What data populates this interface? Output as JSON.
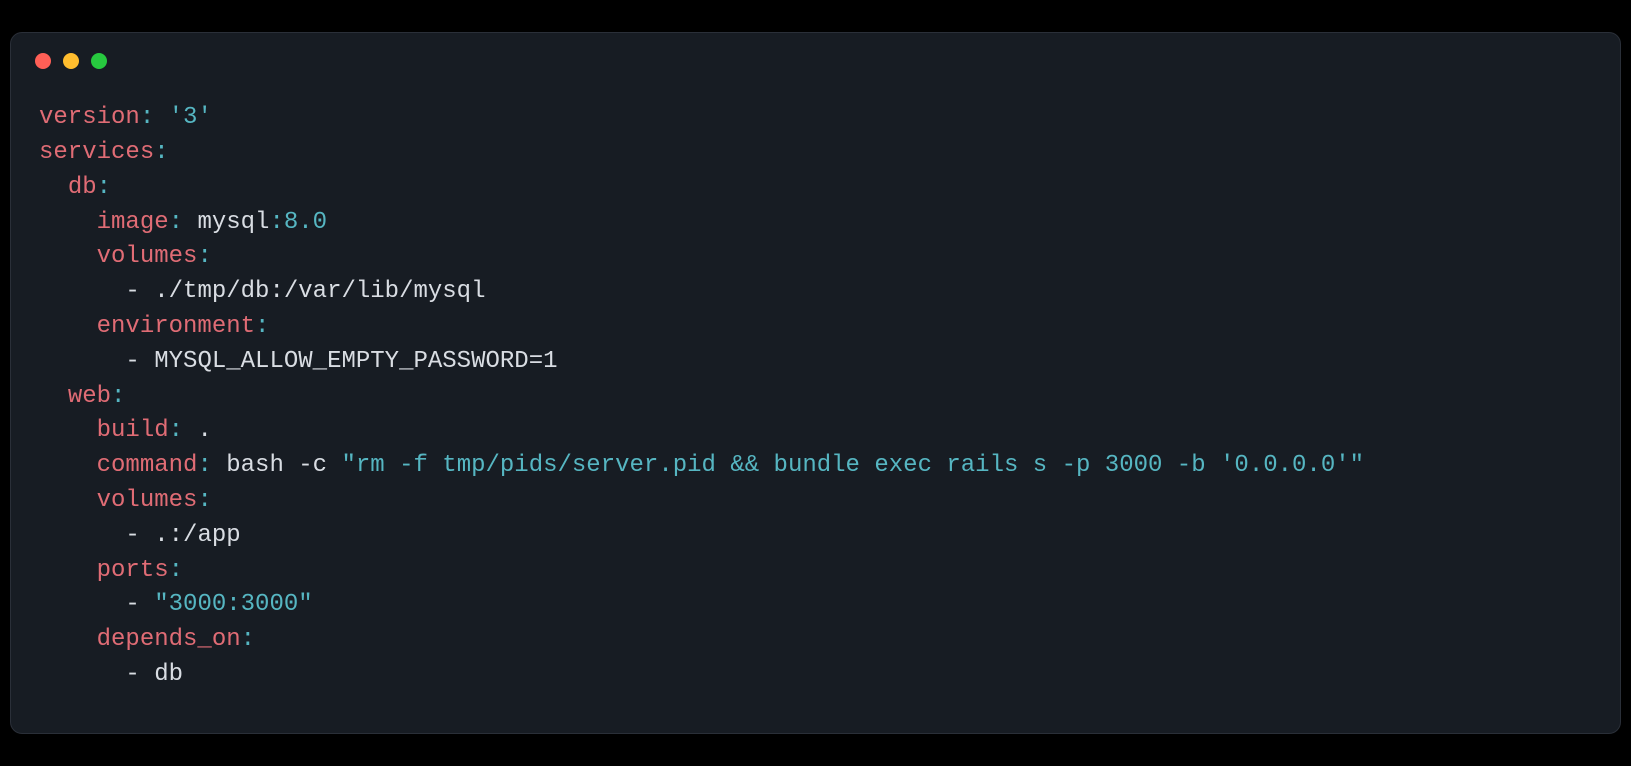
{
  "yaml": {
    "version_key": "version",
    "version_val": "'3'",
    "services_key": "services",
    "db_key": "db",
    "image_key": "image",
    "image_val_pre": "mysql",
    "image_val_post": "8.0",
    "volumes_key": "volumes",
    "db_volume": "./tmp/db:/var/lib/mysql",
    "environment_key": "environment",
    "db_env": "MYSQL_ALLOW_EMPTY_PASSWORD=1",
    "web_key": "web",
    "build_key": "build",
    "build_val": ".",
    "command_key": "command",
    "command_pre": "bash -c ",
    "command_str": "\"rm -f tmp/pids/server.pid && bundle exec rails s -p 3000 -b '0.0.0.0'\"",
    "web_volume": ".:/app",
    "ports_key": "ports",
    "ports_val": "\"3000:3000\"",
    "depends_on_key": "depends_on",
    "depends_on_val": "db"
  }
}
